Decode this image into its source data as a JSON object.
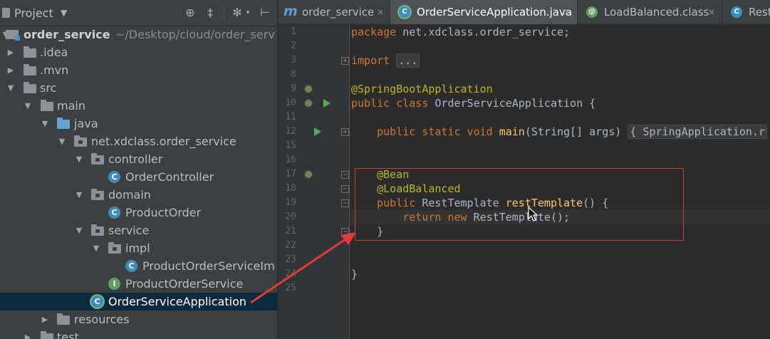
{
  "project_panel": {
    "title": "Project",
    "dropdown_icon": "chevron-down-icon",
    "toolbar_icons": [
      "crosshair-icon",
      "collapse-all-icon",
      "gear-icon",
      "hide-panel-icon"
    ],
    "tree": [
      {
        "label": "order_service",
        "path": "~/Desktop/cloud/order_serv",
        "icon": "module",
        "expanded": true,
        "depth": 0
      },
      {
        "label": ".idea",
        "icon": "folder",
        "expanded": false,
        "depth": 1
      },
      {
        "label": ".mvn",
        "icon": "folder",
        "expanded": false,
        "depth": 1
      },
      {
        "label": "src",
        "icon": "folder",
        "expanded": true,
        "depth": 1
      },
      {
        "label": "main",
        "icon": "folder",
        "expanded": true,
        "depth": 2
      },
      {
        "label": "java",
        "icon": "source-folder",
        "expanded": true,
        "depth": 3
      },
      {
        "label": "net.xdclass.order_service",
        "icon": "package",
        "expanded": true,
        "depth": 4
      },
      {
        "label": "controller",
        "icon": "package",
        "expanded": true,
        "depth": 5
      },
      {
        "label": "OrderController",
        "icon": "class",
        "depth": 6
      },
      {
        "label": "domain",
        "icon": "package",
        "expanded": true,
        "depth": 5
      },
      {
        "label": "ProductOrder",
        "icon": "class",
        "depth": 6
      },
      {
        "label": "service",
        "icon": "package",
        "expanded": true,
        "depth": 5
      },
      {
        "label": "impl",
        "icon": "package",
        "expanded": true,
        "depth": 6
      },
      {
        "label": "ProductOrderServiceIm",
        "icon": "class",
        "depth": 7
      },
      {
        "label": "ProductOrderService",
        "icon": "interface",
        "depth": 6
      },
      {
        "label": "OrderServiceApplication",
        "icon": "spring-app-class",
        "depth": 5,
        "selected": true
      },
      {
        "label": "resources",
        "icon": "resources-folder",
        "expanded": false,
        "depth": 3
      },
      {
        "label": "test",
        "icon": "folder",
        "expanded": false,
        "depth": 2
      }
    ]
  },
  "editor": {
    "tabs": [
      {
        "label": "order_service",
        "icon": "maven-m-icon",
        "active": false,
        "close": "×"
      },
      {
        "label": "OrderServiceApplication.java",
        "icon": "spring-class-icon",
        "active": true,
        "close": "×"
      },
      {
        "label": "LoadBalanced.class",
        "icon": "annotation-icon",
        "active": false,
        "close": "×"
      },
      {
        "label": "Rest",
        "icon": "class-icon",
        "active": false
      }
    ],
    "line_numbers": [
      "1",
      "2",
      "3",
      "8",
      "9",
      "10",
      "11",
      "12",
      "15",
      "16",
      "17",
      "18",
      "19",
      "20",
      "21",
      "22",
      "23",
      "24",
      "25"
    ],
    "code": {
      "l1_kw": "package",
      "l1_rest": " net.xdclass.order_service;",
      "l3_kw": "import",
      "l3_fold": "...",
      "l8": "@SpringBootApplication",
      "l9_kw": "public class",
      "l9_rest": " OrderServiceApplication {",
      "l11_kw": "public static void",
      "l11_fn": " main",
      "l11_rest": "(String[] args) ",
      "l11_fold": "{ SpringApplication.r",
      "l17": "@Bean",
      "l18": "@LoadBalanced",
      "l19_kw": "public",
      "l19_type": " RestTemplate ",
      "l19_fn": "restTemplate",
      "l19_rest": "() {",
      "l20_kw": "return new",
      "l20_rest": " RestTemplate();",
      "l21": "}",
      "l23": "}"
    }
  },
  "colors": {
    "panel_bg": "#3c3f41",
    "editor_bg": "#2b2b2b",
    "selection": "#0d293e",
    "keyword": "#cc7832",
    "annotation": "#bbb529",
    "method": "#ffc66d",
    "annotation_box": "#d93535"
  }
}
